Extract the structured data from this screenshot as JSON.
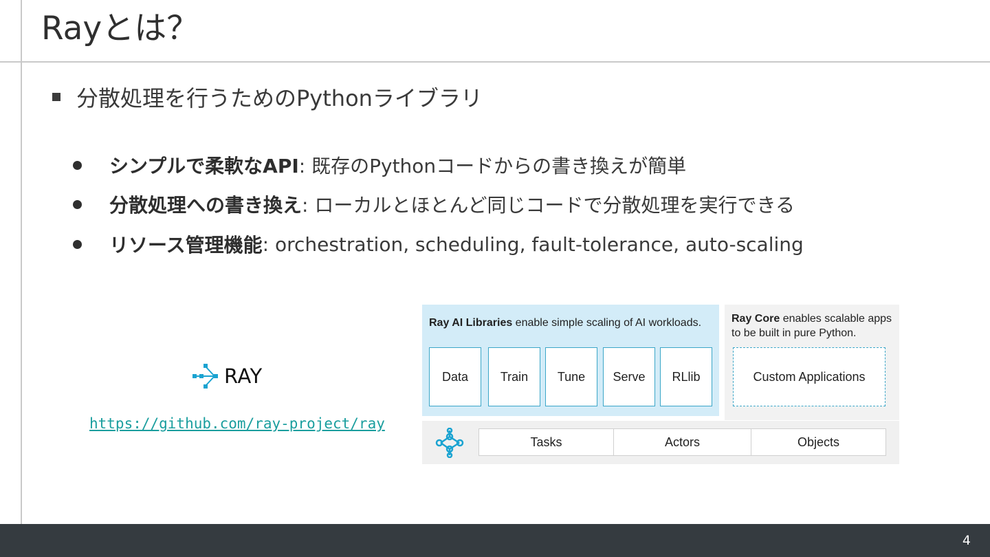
{
  "slide": {
    "title": "Rayとは？",
    "bullet_main": "分散処理を行うためのPythonライブラリ",
    "sub_bullets": [
      {
        "bold": "シンプルで柔軟なAPI",
        "rest": ": 既存のPythonコードからの書き換えが簡単"
      },
      {
        "bold": "分散処理への書き換え",
        "rest": ": ローカルとほとんど同じコードで分散処理を実行できる"
      },
      {
        "bold": "リソース管理機能",
        "rest": ": orchestration, scheduling, fault-tolerance, auto-scaling"
      }
    ],
    "logo_text": "RAY",
    "link": "https://github.com/ray-project/ray",
    "page_number": "4"
  },
  "diagram": {
    "libs_caption_bold": "Ray AI Libraries",
    "libs_caption_rest": " enable simple scaling of AI workloads.",
    "libraries": [
      "Data",
      "Train",
      "Tune",
      "Serve",
      "RLlib"
    ],
    "core_caption_bold": "Ray Core",
    "core_caption_rest": " enables scalable apps to be built in pure Python.",
    "custom_label": "Custom Applications",
    "primitives": [
      "Tasks",
      "Actors",
      "Objects"
    ]
  },
  "colors": {
    "link": "#1a9e9e",
    "libs_bg": "#d3ecf8",
    "box_border": "#3aa6c8",
    "footer_bg": "#353b40",
    "ray_icon": "#1aa3d1"
  }
}
